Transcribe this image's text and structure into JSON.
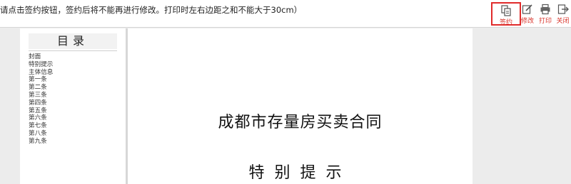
{
  "toolbar": {
    "notice": "请点击签约按钮，签约后将不能再进行修改。打印时左右边距之和不能大于30cm）",
    "buttons": [
      {
        "label": "签约",
        "icon": "sign-icon"
      },
      {
        "label": "修改",
        "icon": "edit-icon"
      },
      {
        "label": "打印",
        "icon": "print-icon"
      },
      {
        "label": "关闭",
        "icon": "close-icon"
      }
    ]
  },
  "toc": {
    "title": "目录",
    "items": [
      "封面",
      "特别提示",
      "主体信息",
      "第一条",
      "第二条",
      "第三条",
      "第四条",
      "第五条",
      "第六条",
      "第七条",
      "第八条",
      "第九条"
    ]
  },
  "document": {
    "title": "成都市存量房买卖合同",
    "subtitle": "特别提示"
  },
  "colors": {
    "accent": "#d9342b",
    "highlight_border": "#e02a2a"
  }
}
